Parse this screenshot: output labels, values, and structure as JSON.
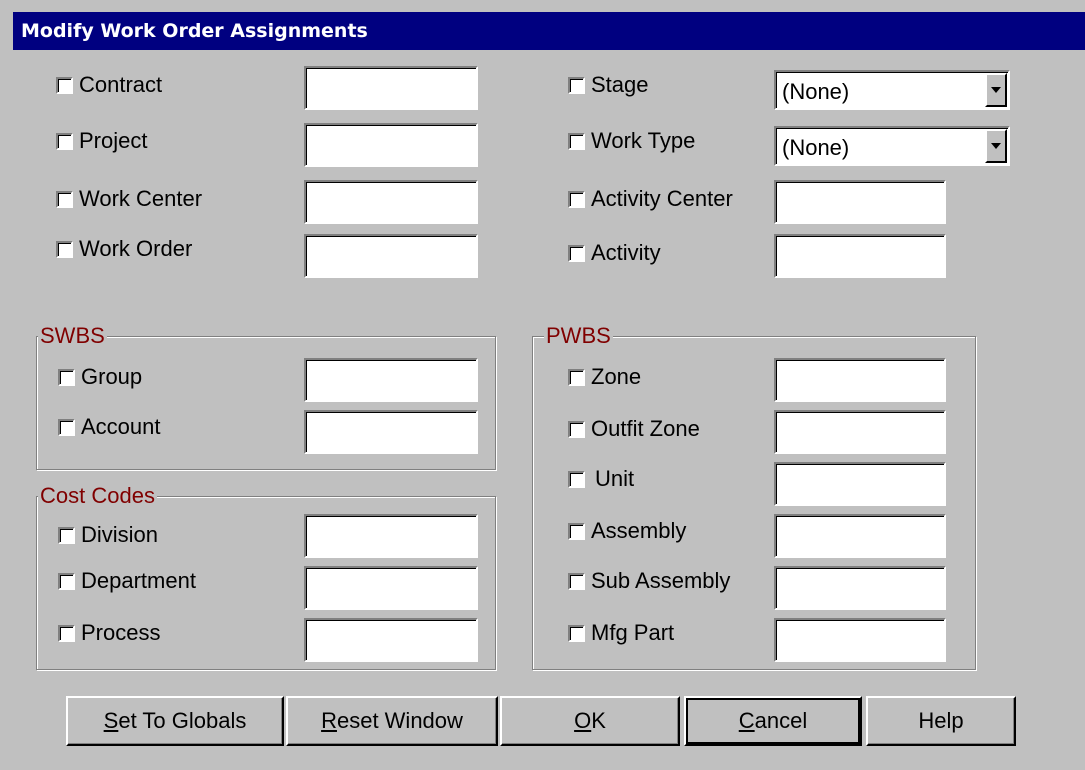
{
  "window": {
    "title": "Modify Work Order Assignments"
  },
  "top_left": [
    {
      "label": "Contract"
    },
    {
      "label": "Project"
    },
    {
      "label": "Work Center"
    },
    {
      "label": "Work Order"
    }
  ],
  "top_right": [
    {
      "label": "Stage",
      "value": "(None)"
    },
    {
      "label": "Work Type",
      "value": "(None)"
    },
    {
      "label": "Activity Center"
    },
    {
      "label": "Activity"
    }
  ],
  "swbs": {
    "title": "SWBS",
    "items": [
      {
        "label": "Group"
      },
      {
        "label": "Account"
      }
    ]
  },
  "cost_codes": {
    "title": "Cost Codes",
    "items": [
      {
        "label": "Division"
      },
      {
        "label": "Department"
      },
      {
        "label": "Process"
      }
    ]
  },
  "pwbs": {
    "title": "PWBS",
    "items": [
      {
        "label": "Zone"
      },
      {
        "label": "Outfit Zone"
      },
      {
        "label": "Unit"
      },
      {
        "label": "Assembly"
      },
      {
        "label": "Sub Assembly"
      },
      {
        "label": "Mfg Part"
      }
    ]
  },
  "buttons": {
    "set_to_globals": {
      "accel": "S",
      "rest": "et To Globals"
    },
    "reset_window": {
      "accel": "R",
      "rest": "eset Window"
    },
    "ok": {
      "accel": "O",
      "rest": "K"
    },
    "cancel": {
      "accel": "C",
      "rest": "ancel"
    },
    "help": {
      "label": "Help"
    }
  }
}
